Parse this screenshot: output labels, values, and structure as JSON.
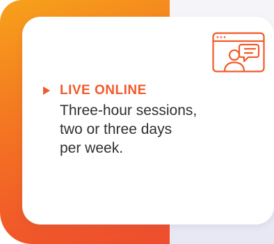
{
  "card": {
    "icon": "video-chat-icon",
    "bullet_icon": "play-triangle-icon",
    "heading": "LIVE ONLINE",
    "description_lines": [
      "Three-hour sessions,",
      "two or three days",
      "per week."
    ]
  },
  "colors": {
    "accent": "#f15a29",
    "gradient_start": "#f7a21b",
    "gradient_end": "#ee4d2d",
    "lavender": "#e8e8f4",
    "text": "#2f2f2f"
  }
}
